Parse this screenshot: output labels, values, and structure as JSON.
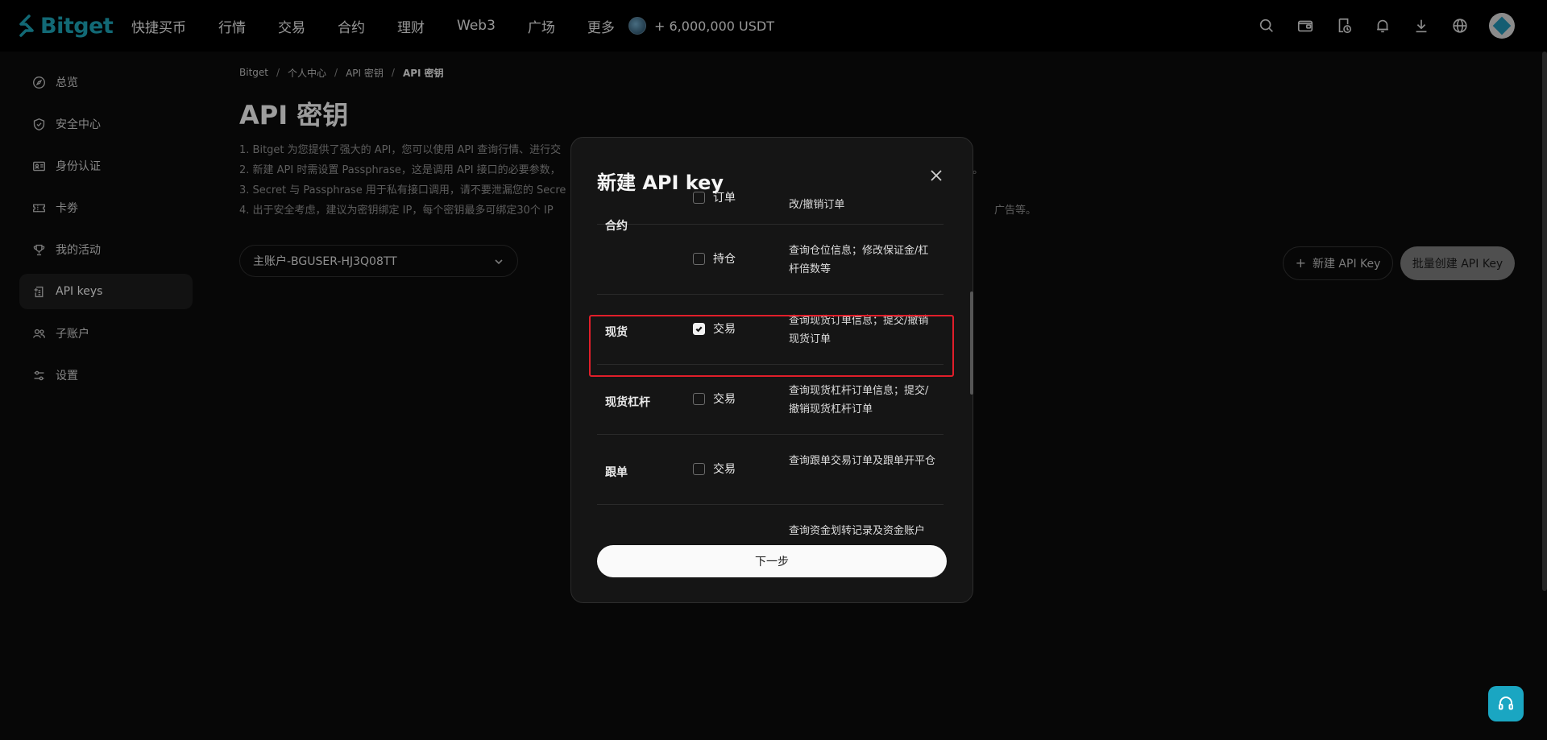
{
  "brand": {
    "name": "Bitget",
    "accent": "#1da2b4"
  },
  "nav": {
    "items": [
      "快捷买币",
      "行情",
      "交易",
      "合约",
      "理财",
      "Web3",
      "广场",
      "更多"
    ],
    "promo": "+ 6,000,000 USDT"
  },
  "top_icons": [
    "search-icon",
    "wallet-icon",
    "orders-icon",
    "bell-icon",
    "download-icon",
    "globe-icon",
    "avatar"
  ],
  "sidebar": {
    "items": [
      {
        "label": "总览",
        "icon": "compass-icon"
      },
      {
        "label": "安全中心",
        "icon": "shield-icon"
      },
      {
        "label": "身份认证",
        "icon": "id-card-icon"
      },
      {
        "label": "卡劵",
        "icon": "ticket-icon"
      },
      {
        "label": "我的活动",
        "icon": "trophy-icon"
      },
      {
        "label": "API keys",
        "icon": "api-icon",
        "active": true
      },
      {
        "label": "子账户",
        "icon": "users-icon"
      },
      {
        "label": "设置",
        "icon": "sliders-icon"
      }
    ]
  },
  "breadcrumb": [
    "Bitget",
    "个人中心",
    "API 密钥",
    "API 密钥"
  ],
  "page": {
    "title": "API 密钥",
    "desc": [
      "1. Bitget 为您提供了强大的 API，您可以使用 API 查询行情、进行交",
      "2. 新建 API 时需设置 Passphrase，这是调用 API 接口的必要参数，",
      "3. Secret 与 Passphrase 用于私有接口调用，请不要泄漏您的 Secre",
      "4. 出于安全考虑，建议为密钥绑定 IP，每个密钥最多可绑定30个 IP"
    ],
    "desc_tail": [
      "。",
      "广告等。"
    ],
    "account": "主账户-BGUSER-HJ3Q08TT",
    "new_button": "新建 API Key",
    "batch_button": "批量创建 API Key"
  },
  "modal": {
    "title": "新建 API key",
    "rows": [
      {
        "category": "",
        "perm": "订单",
        "checked": false,
        "desc": "改/撤销订单"
      },
      {
        "category": "合约",
        "perm": "持仓",
        "checked": false,
        "desc": "查询仓位信息；修改保证金/杠杆倍数等"
      },
      {
        "category": "现货",
        "perm": "交易",
        "checked": true,
        "desc": "查询现货订单信息；提交/撤销现货订单"
      },
      {
        "category": "现货杠杆",
        "perm": "交易",
        "checked": false,
        "desc": "查询现货杠杆订单信息；提交/撤销现货杠杆订单"
      },
      {
        "category": "跟单",
        "perm": "交易",
        "checked": false,
        "desc": "查询跟单交易订单及跟单开平仓"
      },
      {
        "category": "",
        "perm": "",
        "checked": false,
        "desc": "查询资金划转记录及资金账户"
      }
    ],
    "next_button": "下一步",
    "highlight_color": "#e01e2a"
  },
  "support": {
    "icon": "headset-icon"
  }
}
